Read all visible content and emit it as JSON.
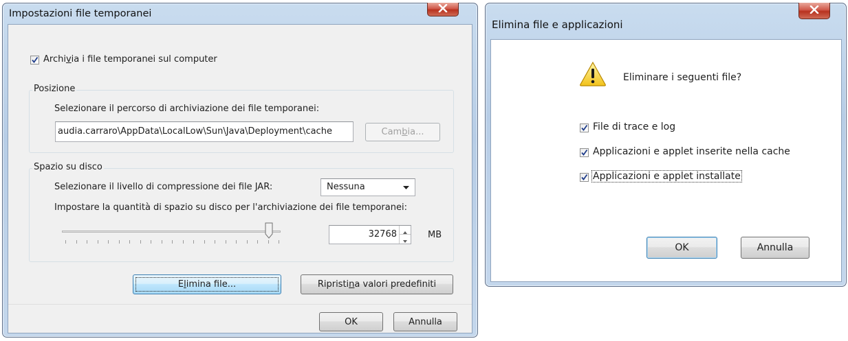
{
  "dialog_temp": {
    "title": "Impostazioni file temporanei",
    "keep_files": {
      "checked": true,
      "label_pre": "Archi",
      "label_key": "v",
      "label_post": "ia i file temporanei sul computer"
    },
    "location": {
      "group_label": "Posizione",
      "prompt": "Selezionare il percorso di archiviazione dei file temporanei:",
      "path": "audia.carraro\\AppData\\LocalLow\\Sun\\Java\\Deployment\\cache",
      "change_pre": "Cam",
      "change_key": "b",
      "change_post": "ia..."
    },
    "disk": {
      "group_label": "Spazio su disco",
      "compression_label": "Selezionare il livello di compressione dei file JAR:",
      "compression_value": "Nessuna",
      "space_label": "Impostare la quantità di spazio su disco per l'archiviazione dei file temporanei:",
      "size_value": "32768",
      "size_unit": "MB",
      "slider_level": 0.96
    },
    "delete_pre": "E",
    "delete_key": "l",
    "delete_post": "imina file...",
    "restore_pre": "Ripristi",
    "restore_key": "n",
    "restore_post": "a valori predefiniti",
    "ok": "OK",
    "cancel": "Annulla"
  },
  "dialog_delete": {
    "title": "Elimina file e applicazioni",
    "question": "Eliminare i seguenti file?",
    "options": [
      {
        "label": "File di trace e log",
        "checked": true
      },
      {
        "label": "Applicazioni e applet inserite nella cache",
        "checked": true
      },
      {
        "label": "Applicazioni e applet installate",
        "checked": true
      }
    ],
    "ok": "OK",
    "cancel": "Annulla"
  }
}
